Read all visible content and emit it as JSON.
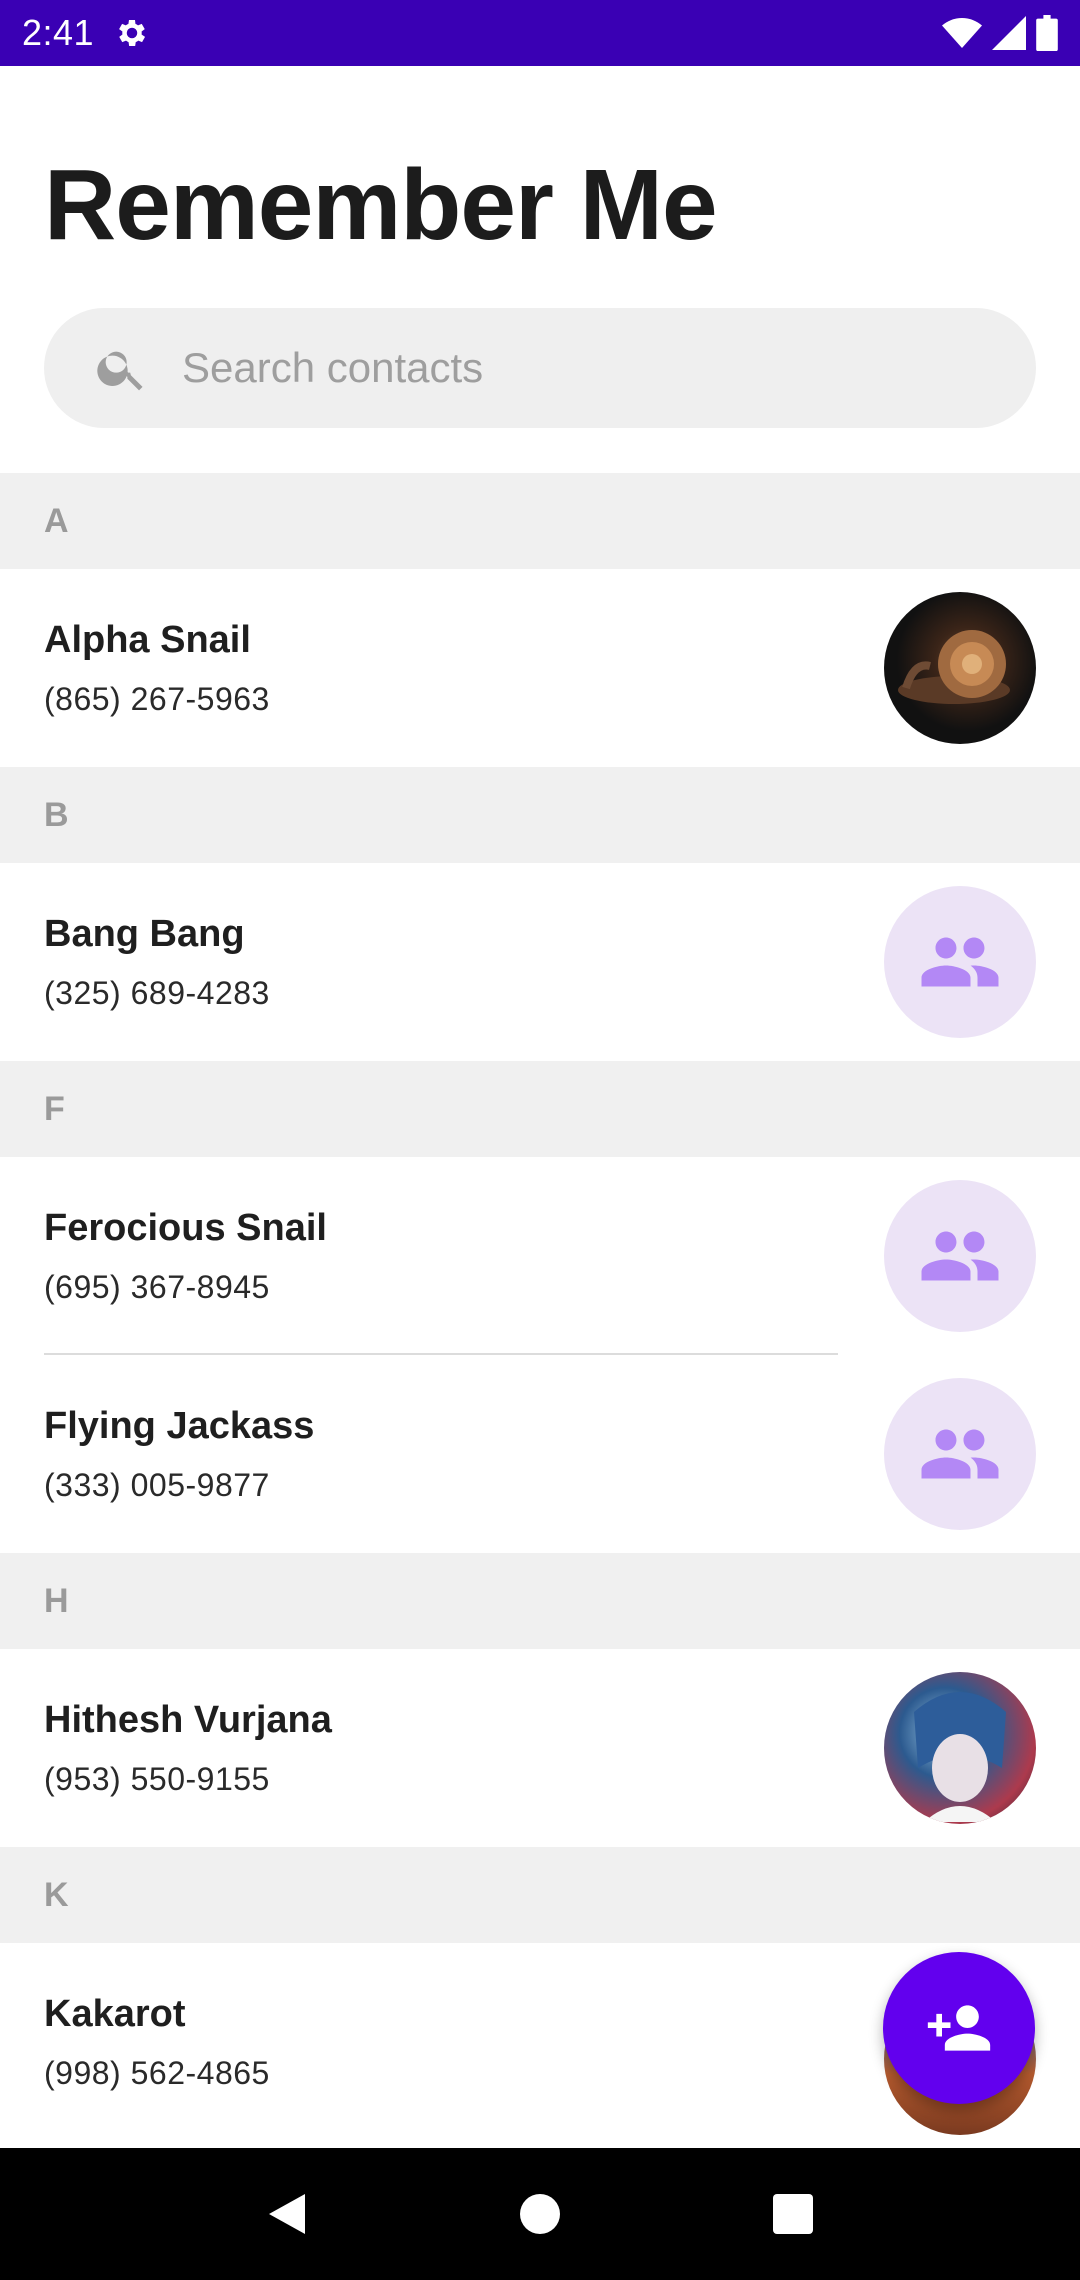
{
  "status_bar": {
    "time": "2:41"
  },
  "app": {
    "title": "Remember Me"
  },
  "search": {
    "placeholder": "Search contacts",
    "value": ""
  },
  "sections": [
    {
      "letter": "A",
      "contacts": [
        {
          "name": "Alpha Snail",
          "phone": "(865) 267-5963",
          "avatar": "photo-snail"
        }
      ]
    },
    {
      "letter": "B",
      "contacts": [
        {
          "name": "Bang Bang",
          "phone": "(325) 689-4283",
          "avatar": "group-icon"
        }
      ]
    },
    {
      "letter": "F",
      "contacts": [
        {
          "name": "Ferocious Snail",
          "phone": "(695) 367-8945",
          "avatar": "group-icon"
        },
        {
          "name": "Flying Jackass",
          "phone": "(333) 005-9877",
          "avatar": "group-icon"
        }
      ]
    },
    {
      "letter": "H",
      "contacts": [
        {
          "name": "Hithesh Vurjana",
          "phone": "(953) 550-9155",
          "avatar": "photo-anime"
        }
      ]
    },
    {
      "letter": "K",
      "contacts": [
        {
          "name": "Kakarot",
          "phone": "(998) 562-4865",
          "avatar": "photo-kakarot"
        }
      ]
    }
  ],
  "fab": {
    "icon": "add-person-icon"
  },
  "nav": {
    "back": "back-icon",
    "home": "home-icon",
    "recents": "recents-icon"
  },
  "colors": {
    "status_bar": "#3a00b4",
    "accent": "#6200ee",
    "avatar_placeholder_bg": "#ece3f6",
    "avatar_placeholder_icon": "#b388f5"
  }
}
